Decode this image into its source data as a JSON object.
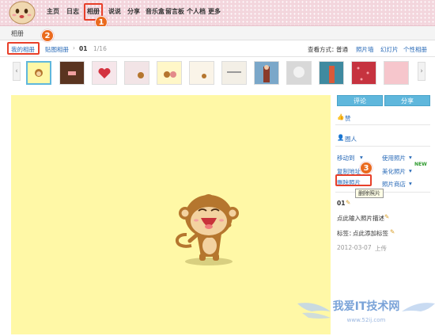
{
  "nav": {
    "items": [
      "主页",
      "日志",
      "相册",
      "说说",
      "分享",
      "音乐盒",
      "留言板",
      "个人档",
      "更多"
    ]
  },
  "callouts": [
    "1",
    "2",
    "3"
  ],
  "breadcrumb": "相册",
  "album_bar": {
    "my_album": "我的相册",
    "stuck_album": "贴图相册",
    "separator": "›",
    "index": "01",
    "count": "1/16",
    "view_label": "查看方式：",
    "views": [
      "普通",
      "照片墙",
      "幻灯片",
      "个性相册"
    ]
  },
  "strip": {
    "prev": "‹",
    "next": "›"
  },
  "panel": {
    "comment_btn": "评论",
    "share_btn": "分享",
    "like": "赞",
    "faces": "圈人",
    "move_to": "移动到",
    "use_photo": "使用照片",
    "copy_link": "复制地址",
    "beautify": "美化照片",
    "new_badge": "NEW",
    "delete": "删除照片",
    "photo_shop": "照片商店",
    "tooltip": "删除照片",
    "photo_name": "01",
    "add_desc": "点此输入照片描述",
    "tags_label": "标签：",
    "add_tags": "点此添加标签",
    "upload_date": "2012-03-07",
    "upload_label": "上传",
    "caret": "▾"
  },
  "watermark": {
    "text": "我爱IT技术网",
    "url": "www.52ij.com"
  },
  "colors": {
    "accent": "#e8402a",
    "callout": "#ea6a1e",
    "button": "#5fb7dc",
    "photo_bg": "#fff8a6"
  }
}
